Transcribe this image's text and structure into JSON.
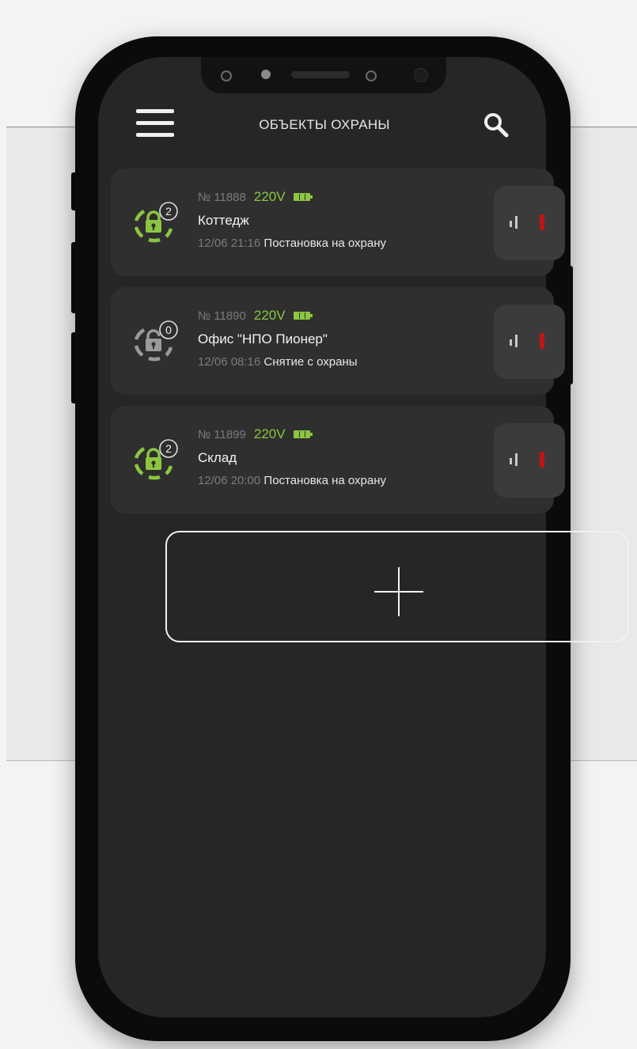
{
  "header": {
    "title": "ОБЪЕКТЫ ОХРАНЫ",
    "menu_icon": "hamburger-menu-icon",
    "search_icon": "search-icon"
  },
  "objects": [
    {
      "number": "№ 11888",
      "voltage": "220V",
      "name": "Коттедж",
      "time": "12/06 21:16",
      "event": "Постановка на охрану",
      "badge": "2",
      "state": "armed"
    },
    {
      "number": "№ 11890",
      "voltage": "220V",
      "name": "Офис \"НПО Пионер\"",
      "time": "12/06 08:16",
      "event": "Снятие с охраны",
      "badge": "0",
      "state": "disarmed"
    },
    {
      "number": "№ 11899",
      "voltage": "220V",
      "name": "Склад",
      "time": "12/06 20:00",
      "event": "Постановка на охрану",
      "badge": "2",
      "state": "armed"
    }
  ],
  "add_button": {
    "icon": "plus-icon"
  },
  "colors": {
    "accent_green": "#8cc63f",
    "alert_red": "#c01515",
    "screen_bg": "#262626",
    "card_bg": "#2f2f2f"
  }
}
